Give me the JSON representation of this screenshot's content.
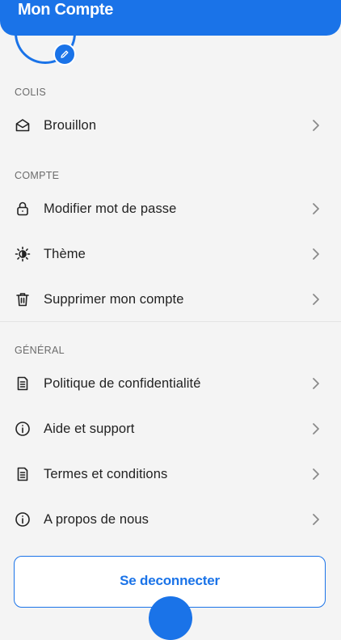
{
  "header": {
    "title": "Mon Compte"
  },
  "sections": {
    "colis": {
      "label": "COLIS",
      "items": [
        {
          "label": "Brouillon",
          "icon": "envelope-open-icon"
        }
      ]
    },
    "compte": {
      "label": "COMPTE",
      "items": [
        {
          "label": "Modifier mot de passe",
          "icon": "lock-icon"
        },
        {
          "label": "Thème",
          "icon": "theme-icon"
        },
        {
          "label": "Supprimer mon compte",
          "icon": "trash-icon"
        }
      ]
    },
    "general": {
      "label": "GÉNÉRAL",
      "items": [
        {
          "label": "Politique de confidentialité",
          "icon": "document-icon"
        },
        {
          "label": "Aide et support",
          "icon": "info-icon"
        },
        {
          "label": "Termes et conditions",
          "icon": "document-icon"
        },
        {
          "label": "A propos de nous",
          "icon": "info-icon"
        }
      ]
    }
  },
  "logout": {
    "label": "Se deconnecter"
  },
  "colors": {
    "accent": "#1a73e8",
    "background": "#f4f4f4"
  }
}
